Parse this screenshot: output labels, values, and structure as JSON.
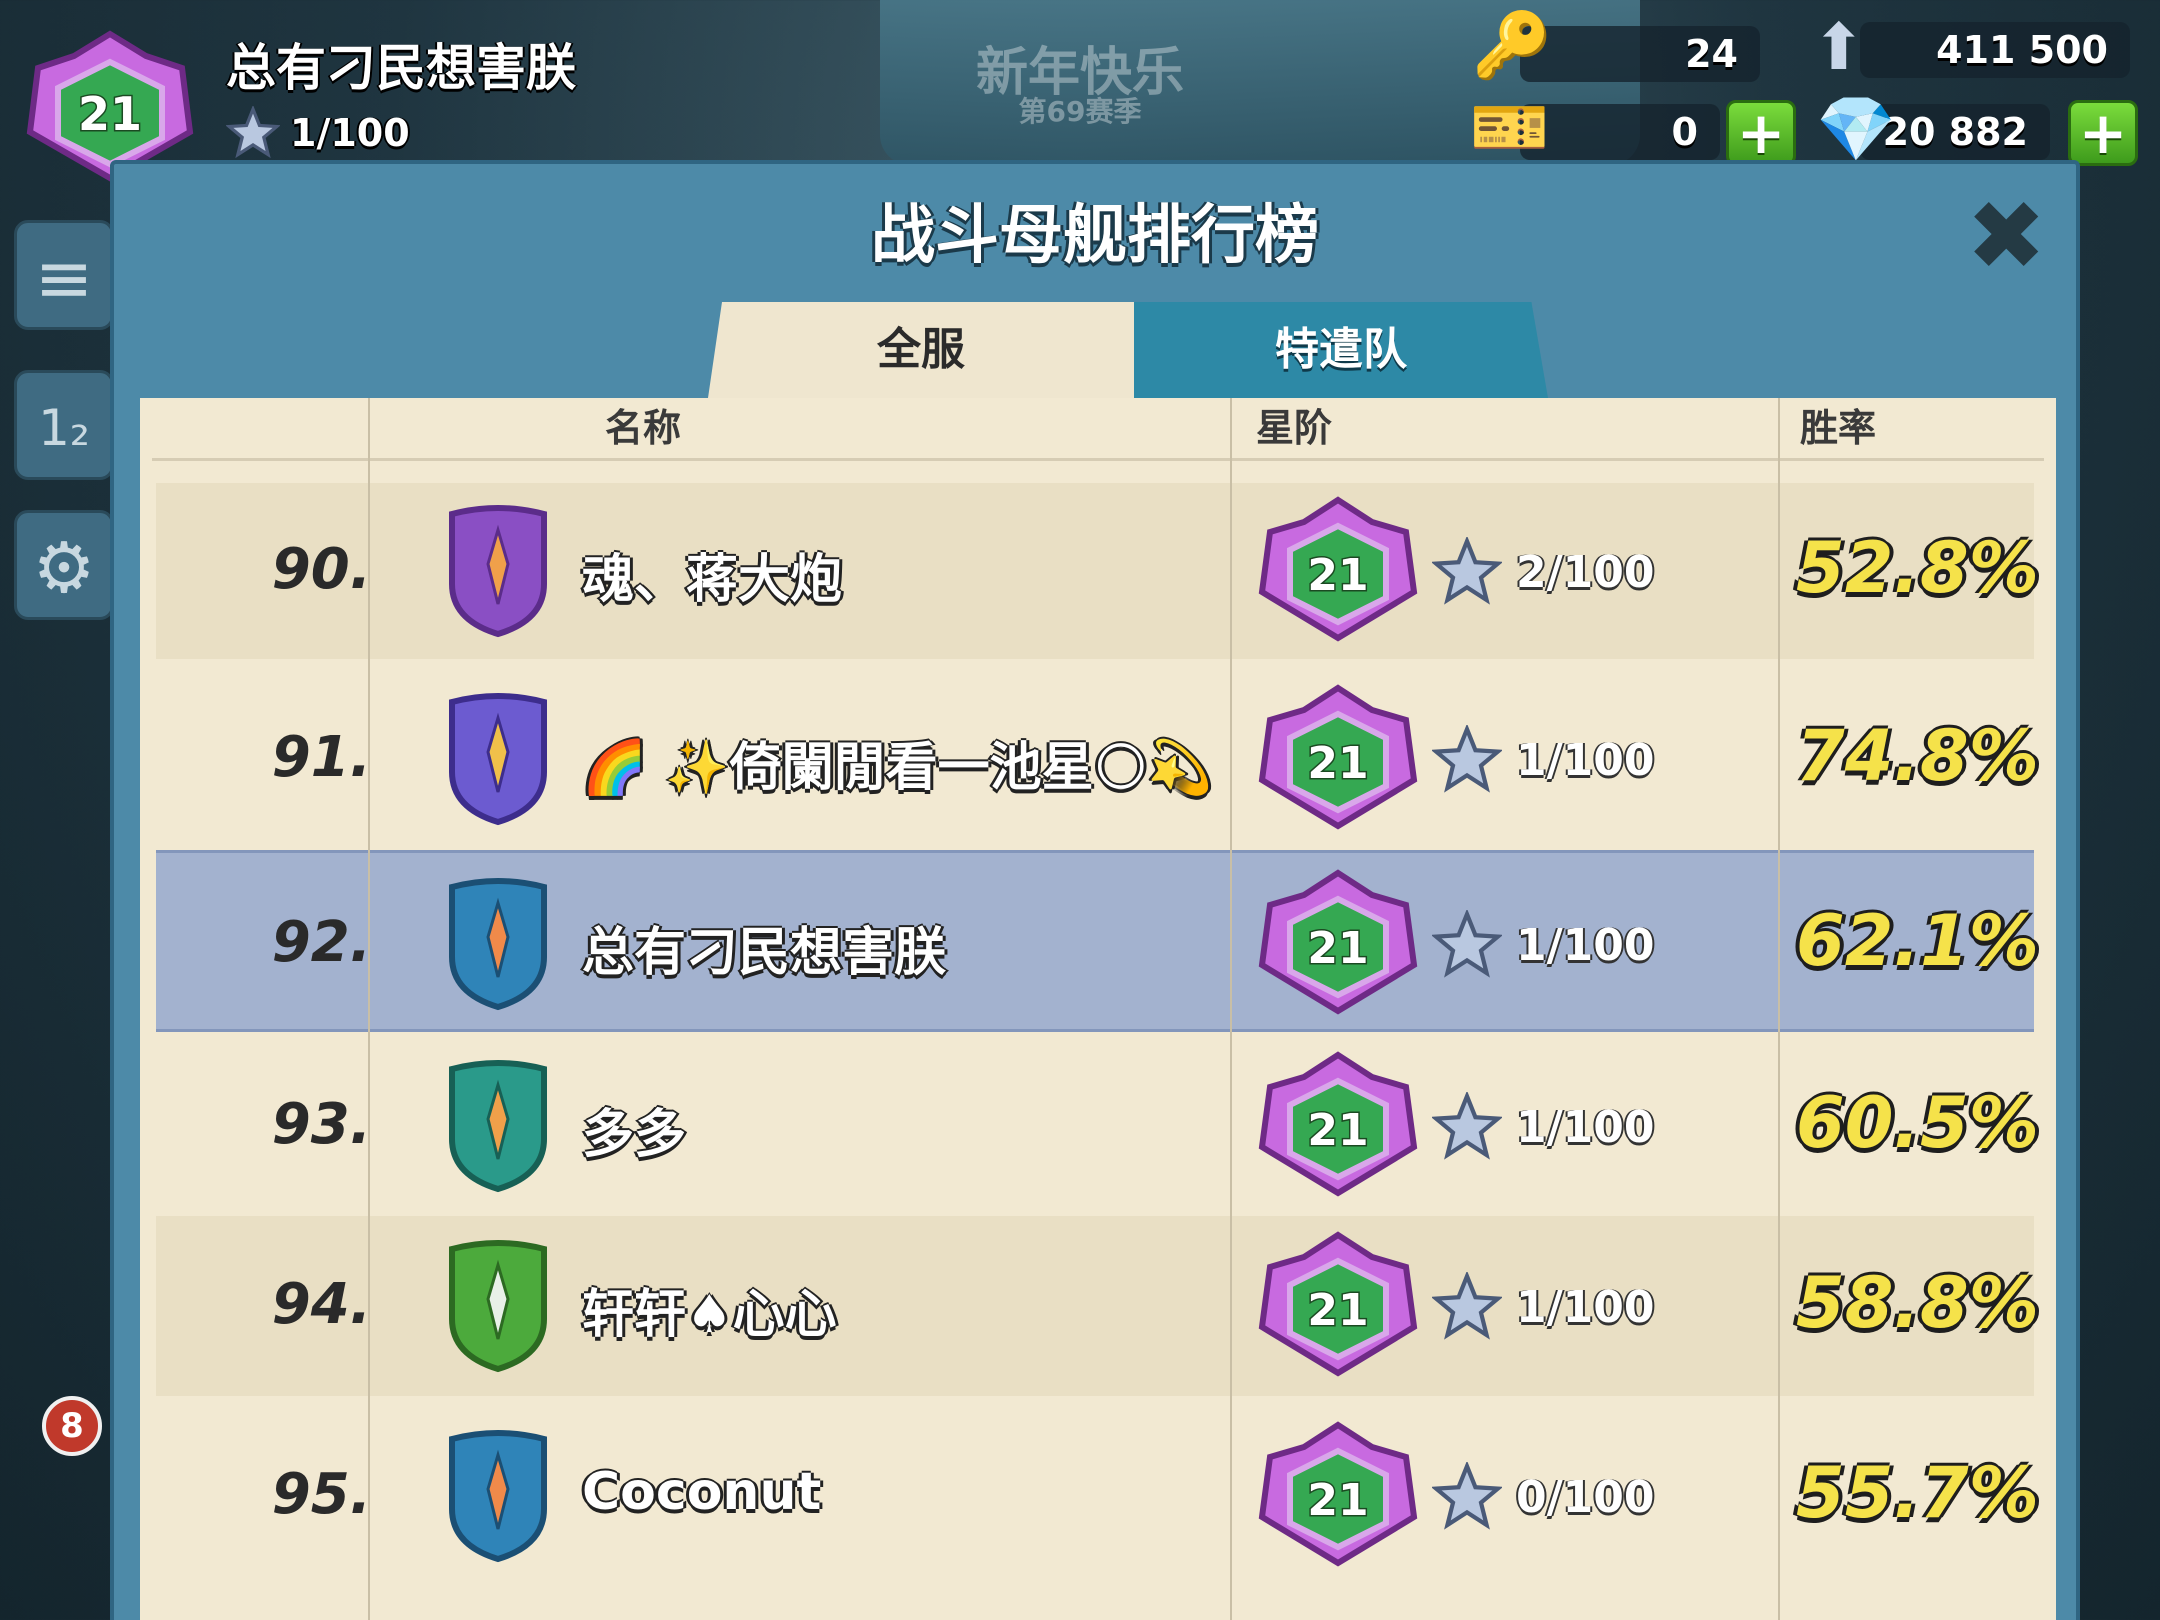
{
  "background": {
    "banner_title": "新年快乐",
    "banner_season": "第69赛季",
    "left_button_count": "8"
  },
  "header": {
    "player_level": "21",
    "player_name": "总有刁民想害朕",
    "player_stars": "1/100"
  },
  "resources": {
    "keys": "24",
    "intel": "411 500",
    "tickets": "0",
    "gems": "20 882"
  },
  "modal": {
    "title": "战斗母舰排行榜",
    "tabs": [
      {
        "label": "全服",
        "active": true
      },
      {
        "label": "特遣队",
        "active": false
      }
    ],
    "columns": {
      "name": "名称",
      "rank_tier": "星阶",
      "win_rate": "胜率"
    },
    "rows": [
      {
        "rank": "90.",
        "badge": "wolf-shield-icon",
        "name": "魂、蒋大炮",
        "level": "21",
        "stars": "2/100",
        "win_rate": "52.8%",
        "highlight": false
      },
      {
        "rank": "91.",
        "badge": "fist-lightning-shield-icon",
        "name": "🌈 ✨倚闌閒看一池星🌕💫",
        "level": "21",
        "stars": "1/100",
        "win_rate": "74.8%",
        "highlight": false
      },
      {
        "rank": "92.",
        "badge": "sword-shield-icon",
        "name": "总有刁民想害朕",
        "level": "21",
        "stars": "1/100",
        "win_rate": "62.1%",
        "highlight": true
      },
      {
        "rank": "93.",
        "badge": "chevron-stripes-shield-icon",
        "name": "多多",
        "level": "21",
        "stars": "1/100",
        "win_rate": "60.5%",
        "highlight": false
      },
      {
        "rank": "94.",
        "badge": "chevron-stars-shield-icon",
        "name": "轩轩♠心心",
        "level": "21",
        "stars": "1/100",
        "win_rate": "58.8%",
        "highlight": false
      },
      {
        "rank": "95.",
        "badge": "sword-shield-icon",
        "name": "Coconut",
        "level": "21",
        "stars": "0/100",
        "win_rate": "55.7%",
        "highlight": false
      }
    ]
  },
  "colors": {
    "modal_frame": "#4d8aa8",
    "paper": "#f2e9d2",
    "highlight_row": "#a3b2cf",
    "win_rate": "#f5e24a",
    "level_gem": "#b35bd0",
    "level_center": "#2f9c4a"
  }
}
